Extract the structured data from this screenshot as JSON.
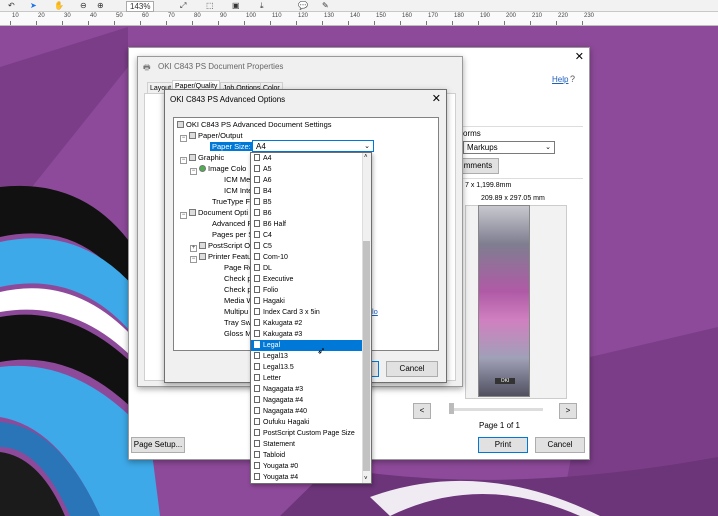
{
  "toolbar": {
    "zoom": "143%"
  },
  "ruler": {
    "marks": [
      "10",
      "20",
      "30",
      "40",
      "50",
      "60",
      "70",
      "80",
      "90",
      "100",
      "110",
      "120",
      "130",
      "140",
      "150",
      "160",
      "170",
      "180",
      "190",
      "200",
      "210",
      "220",
      "230"
    ]
  },
  "print_dialog": {
    "help": "Help",
    "forms_label": "orms",
    "markups_value": "Markups",
    "comments_btn": "mments",
    "size_text": "7 x 1,199.8mm",
    "page_dims": "209.89 x 297.05 mm",
    "page_of": "Page 1 of 1",
    "print_btn": "Print",
    "cancel_btn": "Cancel",
    "page_setup_btn": "Page Setup...",
    "prev_btn": "<",
    "next_btn": ">"
  },
  "props": {
    "title": "OKI C843 PS Document Properties",
    "tabs": [
      "Layout",
      "Paper/Quality",
      "Job Options",
      "Color"
    ]
  },
  "adv": {
    "title": "OKI C843 PS Advanced Options",
    "ok_btn": "",
    "cancel_btn": "Cancel",
    "tree": {
      "root": "OKI C843 PS Advanced Document Settings",
      "paper_output": "Paper/Output",
      "paper_size_label": "Paper Size:",
      "paper_size_value": "A4",
      "graphic": "Graphic",
      "image_color": "Image Colo",
      "icm_method": "ICM Met",
      "icm_intent": "ICM Inte",
      "truetype": "TrueType Fo",
      "document_options": "Document Opti",
      "advanced_printing": "Advanced P",
      "pages_per_sheet": "Pages per Sh",
      "postscript_options": "PostScript O",
      "printer_features": "Printer Featu",
      "page_rotate": "Page Ro",
      "check_1": "Check p",
      "check_2": "Check p",
      "media_weight": "Media W",
      "multipurpose": "Multipu",
      "tray_switch": "Tray Swi",
      "gloss_mode": "Gloss M"
    },
    "link_fragment": "lo"
  },
  "paper_list": {
    "selected": "Legal",
    "items": [
      "A4",
      "A5",
      "A6",
      "B4",
      "B5",
      "B6",
      "B6 Half",
      "C4",
      "C5",
      "Com-10",
      "DL",
      "Executive",
      "Folio",
      "Hagaki",
      "Index Card 3 x 5in",
      "Kakugata #2",
      "Kakugata #3",
      "Legal",
      "Legal13",
      "Legal13.5",
      "Letter",
      "Nagagata #3",
      "Nagagata #4",
      "Nagagata #40",
      "Oufuku Hagaki",
      "PostScript Custom Page Size",
      "Statement",
      "Tabloid",
      "Yougata #0",
      "Yougata #4"
    ]
  },
  "colors": {
    "desktop": "#8e4a9a",
    "selection": "#0078d7",
    "stripe_blue": "#38a6e6"
  }
}
